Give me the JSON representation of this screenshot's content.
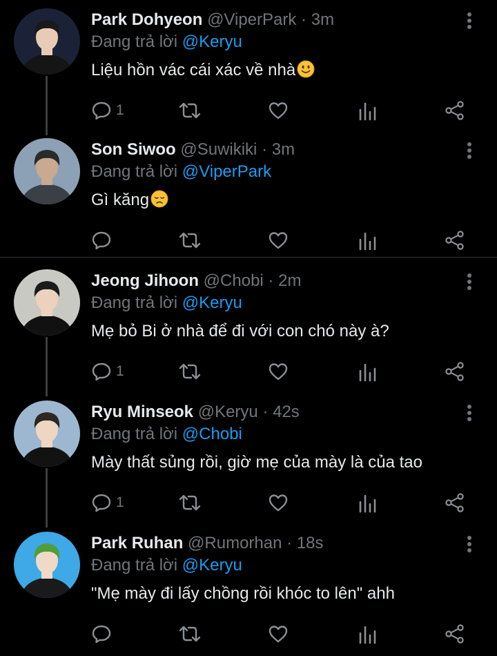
{
  "tweets": [
    {
      "name": "Park Dohyeon",
      "handle": "@ViperPark",
      "dot": "·",
      "time": "3m",
      "reply_prefix": "Đang trả lời",
      "reply_to": "@Keryu",
      "text": "Liệu hồn vác cái xác về nhà",
      "emoji": "slightly-smiling-face",
      "reply_count": "1",
      "avatar_colors": {
        "bg": "#1b2238",
        "hair": "#1a1a1a",
        "skin": "#e8cbb4",
        "shirt": "#151515"
      }
    },
    {
      "name": "Son Siwoo",
      "handle": "@Suwikiki",
      "dot": "·",
      "time": "3m",
      "reply_prefix": "Đang trả lời",
      "reply_to": "@ViperPark",
      "text": "Gì kăng",
      "emoji": "disappointed-face",
      "reply_count": "",
      "avatar_colors": {
        "bg": "#8ca1b5",
        "hair": "#2a2a2a",
        "skin": "#c9a98f",
        "shirt": "#3b3f46"
      }
    },
    {
      "name": "Jeong Jihoon",
      "handle": "@Chobi",
      "dot": "·",
      "time": "2m",
      "reply_prefix": "Đang trả lời",
      "reply_to": "@Keryu",
      "text": "Mẹ bỏ Bi ở nhà để đi với con chó này à?",
      "emoji": "",
      "reply_count": "1",
      "avatar_colors": {
        "bg": "#c9c9c4",
        "hair": "#1b1b1b",
        "skin": "#ecd2bd",
        "shirt": "#111111"
      }
    },
    {
      "name": "Ryu Minseok",
      "handle": "@Keryu",
      "dot": "·",
      "time": "42s",
      "reply_prefix": "Đang trả lời",
      "reply_to": "@Chobi",
      "text": "Mày thất sủng rồi, giờ mẹ của mày là của tao",
      "emoji": "",
      "reply_count": "1",
      "avatar_colors": {
        "bg": "#9db7d1",
        "hair": "#2e2722",
        "skin": "#efd6c2",
        "shirt": "#121212"
      }
    },
    {
      "name": "Park Ruhan",
      "handle": "@Rumorhan",
      "dot": "·",
      "time": "18s",
      "reply_prefix": "Đang trả lời",
      "reply_to": "@Keryu",
      "text": "\"Mẹ mày đi lấy chồng rồi khóc to lên\" ahh",
      "emoji": "",
      "reply_count": "",
      "avatar_colors": {
        "bg": "#3fa8e6",
        "hair": "#4e9f3c",
        "skin": "#f1d9c8",
        "shirt": "#1a1a1a"
      }
    }
  ]
}
